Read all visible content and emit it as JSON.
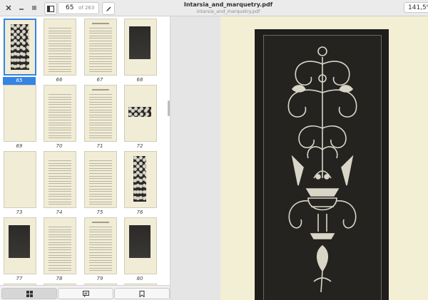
{
  "header": {
    "page_current": "65",
    "page_of": "of 263",
    "title": "Intarsia_and_marquetry.pdf",
    "subtitle": "intarsia_and_marquetry.pdf",
    "zoom": "141,5%"
  },
  "sidebar": {
    "thumbnails": [
      {
        "label": "65",
        "kind": "plate-panel",
        "selected": true
      },
      {
        "label": "66",
        "kind": "text"
      },
      {
        "label": "67",
        "kind": "text-heading"
      },
      {
        "label": "68",
        "kind": "plate-cabinet"
      },
      {
        "label": "69",
        "kind": "blank"
      },
      {
        "label": "70",
        "kind": "text"
      },
      {
        "label": "71",
        "kind": "text-heading"
      },
      {
        "label": "72",
        "kind": "plate-strip"
      },
      {
        "label": "73",
        "kind": "blank"
      },
      {
        "label": "74",
        "kind": "text"
      },
      {
        "label": "75",
        "kind": "text"
      },
      {
        "label": "76",
        "kind": "plate-column"
      },
      {
        "label": "77",
        "kind": "plate-cabinet"
      },
      {
        "label": "78",
        "kind": "text"
      },
      {
        "label": "79",
        "kind": "text-heading"
      },
      {
        "label": "80",
        "kind": "plate-cabinet"
      }
    ],
    "footer_tabs": [
      "thumbnails-icon",
      "annotations-icon",
      "bookmarks-icon"
    ]
  },
  "viewer": {
    "page_bg": "#f2efd5",
    "panel_bg": "#1f1e1c",
    "inlay_color": "#d9d6c8"
  },
  "colors": {
    "accent": "#3584e4"
  }
}
